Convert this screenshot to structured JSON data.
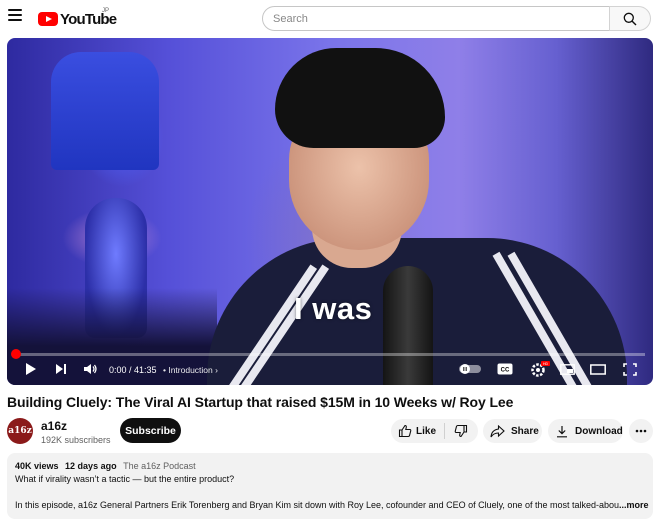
{
  "header": {
    "logo_text": "YouTube",
    "country_code": "JP",
    "search_placeholder": "Search"
  },
  "player": {
    "subtitle": "I was",
    "time": "0:00 / 41:35",
    "chapter": "• Introduction",
    "progress": 0
  },
  "video": {
    "title": "Building Cluely: The Viral AI Startup that raised $15M in 10 Weeks w/ Roy Lee"
  },
  "channel": {
    "avatar_text": "a16z",
    "name": "a16z",
    "subscribers": "192K subscribers",
    "subscribe_label": "Subscribe"
  },
  "actions": {
    "like_label": "Like",
    "share_label": "Share",
    "download_label": "Download"
  },
  "description": {
    "views": "40K views",
    "date": "12 days ago",
    "hashtag": "The a16z Podcast",
    "line1": "What if virality wasn’t a tactic — but the entire product?",
    "line2": "In this episode, a16z General Partners Erik Torenberg and Bryan Kim sit down with Roy Lee, cofounder and CEO of Cluely, one of the most talked-abou",
    "more_label": "...more"
  },
  "colors": {
    "brand_red": "#ff0000",
    "text": "#0f0f0f",
    "secondary_text": "#606060"
  }
}
